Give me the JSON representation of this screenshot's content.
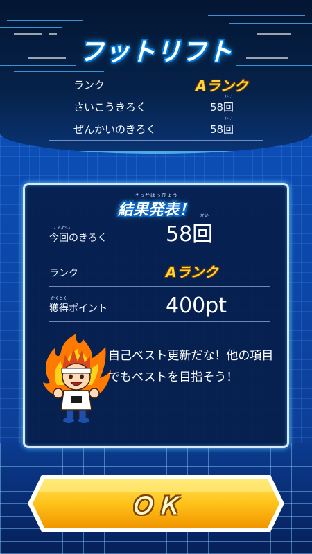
{
  "header": {
    "title": "フットリフト"
  },
  "summary": {
    "rows": [
      {
        "label": "ランク",
        "value": "Aランク",
        "type": "rank"
      },
      {
        "label": "さいこうきろく",
        "value": "58回",
        "ruby": "かい"
      },
      {
        "label": "ぜんかいのきろく",
        "value": "58回",
        "ruby": "かい"
      }
    ]
  },
  "result": {
    "title_ruby": "けっかはっぴょう",
    "title": "結果発表！",
    "record_label": "今回のきろく",
    "record_label_ruby": "こんかい",
    "record_value": "58回",
    "record_value_ruby": "かい",
    "rank_label": "ランク",
    "rank_value": "Aランク",
    "points_label": "獲得ポイント",
    "points_label_ruby": "かくとく",
    "points_value": "400pt",
    "message": "自己ベスト更新だな！他の項目でもベストを目指そう！",
    "mascot_icon": "flaming-hair-character-icon"
  },
  "actions": {
    "ok_label": "ＯＫ"
  },
  "colors": {
    "background": "#0a3f9a",
    "panel": "#061e4a",
    "rank": "#ffd43a",
    "ok_button": "#ffc21a",
    "accent": "#37c6ff"
  }
}
